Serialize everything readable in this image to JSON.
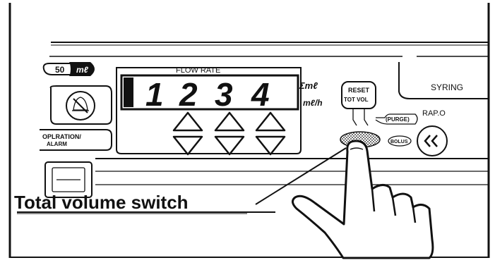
{
  "caption": "Total volume switch",
  "syringe_badge": {
    "size": "50",
    "unit": "mℓ"
  },
  "display": {
    "title": "FLOW RATE",
    "digits": [
      "1",
      "2",
      "3",
      "4"
    ],
    "unit_total": "Σmℓ",
    "unit_rate": "mℓ/h"
  },
  "buttons": {
    "operation_alarm": [
      "OPLRATION/",
      "ALARM"
    ],
    "reset_tot_vol": [
      "RESET",
      "TOT VOL"
    ],
    "syringe": "SYRING",
    "rapid": "RAP.O",
    "purge": "(PURGE)",
    "bolus": "BOLUS"
  },
  "icons": [
    "alarm-silence-icon",
    "double-chevron-left-icon",
    "triangle-up-icon",
    "triangle-down-icon",
    "pointing-hand-icon"
  ]
}
